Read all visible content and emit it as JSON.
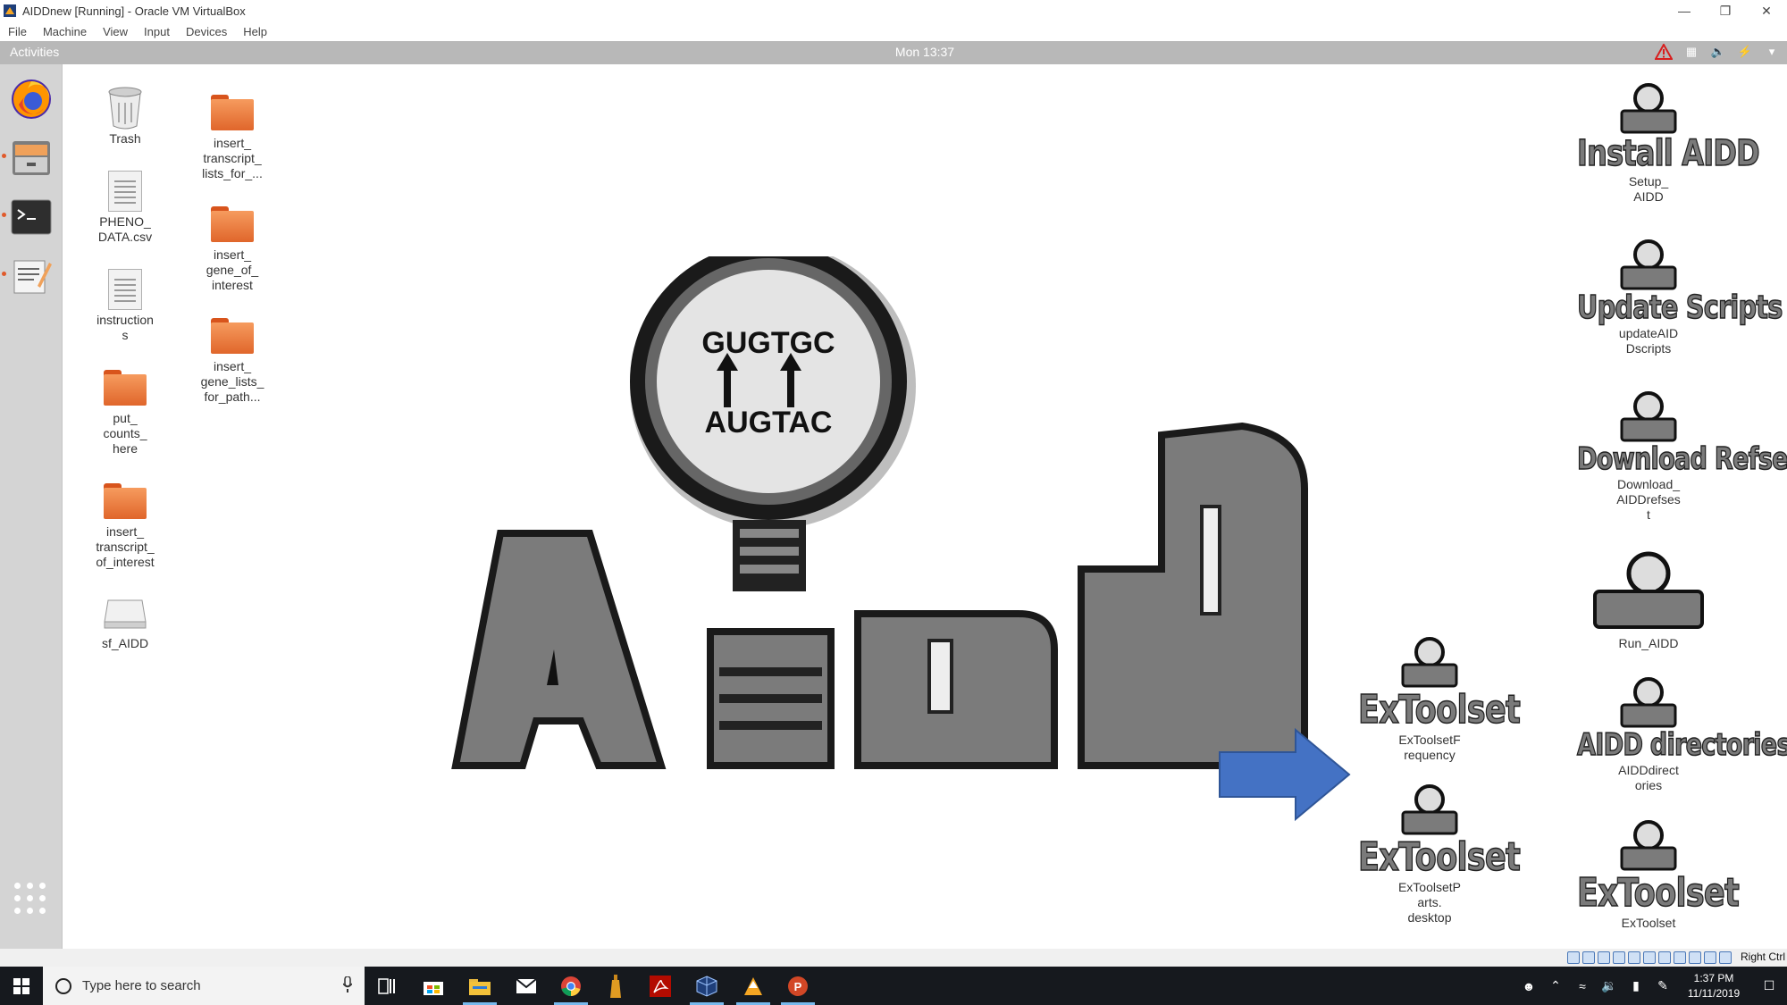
{
  "window": {
    "title": "AIDDnew [Running] - Oracle VM VirtualBox",
    "menu": [
      "File",
      "Machine",
      "View",
      "Input",
      "Devices",
      "Help"
    ]
  },
  "gnome": {
    "activities": "Activities",
    "clock": "Mon 13:37"
  },
  "dock": {
    "items": [
      "firefox-icon",
      "file-cabinet-icon",
      "terminal-icon",
      "text-editor-icon"
    ]
  },
  "desktop": {
    "icons": [
      {
        "label": "Trash",
        "icon": "trash-icon"
      },
      {
        "label": "PHENO_\nDATA.csv",
        "icon": "document-icon"
      },
      {
        "label": "instruction\ns",
        "icon": "document-icon"
      },
      {
        "label": "put_\ncounts_\nhere",
        "icon": "folder-icon"
      },
      {
        "label": "insert_\ntranscript_\nof_interest",
        "icon": "folder-icon"
      },
      {
        "label": "sf_AIDD",
        "icon": "drive-icon"
      },
      {
        "label": "insert_\ntranscript_\nlists_for_...",
        "icon": "folder-icon"
      },
      {
        "label": "insert_\ngene_of_\ninterest",
        "icon": "folder-icon"
      },
      {
        "label": "insert_\ngene_lists_\nfor_path...",
        "icon": "folder-icon"
      }
    ],
    "shortcuts": [
      {
        "banner": "Install AIDD",
        "label": "Setup_\nAIDD"
      },
      {
        "banner": "Update Scripts",
        "label": "updateAID\nDscripts"
      },
      {
        "banner": "Download Refset",
        "label": "Download_\nAIDDrefses\nt"
      },
      {
        "banner": "",
        "label": "Run_AIDD"
      },
      {
        "banner": "AIDD directories",
        "label": "AIDDdirect\nories"
      },
      {
        "banner": "ExToolset",
        "label": "ExToolset"
      },
      {
        "banner": "ExToolset",
        "label": "ExToolsetF\nrequency"
      },
      {
        "banner": "ExToolset",
        "label": "ExToolsetP\narts.\ndesktop"
      }
    ]
  },
  "wallpaper": {
    "top_seq": "GUGTGC",
    "bottom_seq": "AUGTAC",
    "logo_text": "AIDD",
    "arrow_color": "#4472c4"
  },
  "taskbar": {
    "search_placeholder": "Type here to search",
    "time": "1:37 PM",
    "date": "11/11/2019"
  },
  "vbox_status": {
    "host_key": "Right Ctrl"
  }
}
